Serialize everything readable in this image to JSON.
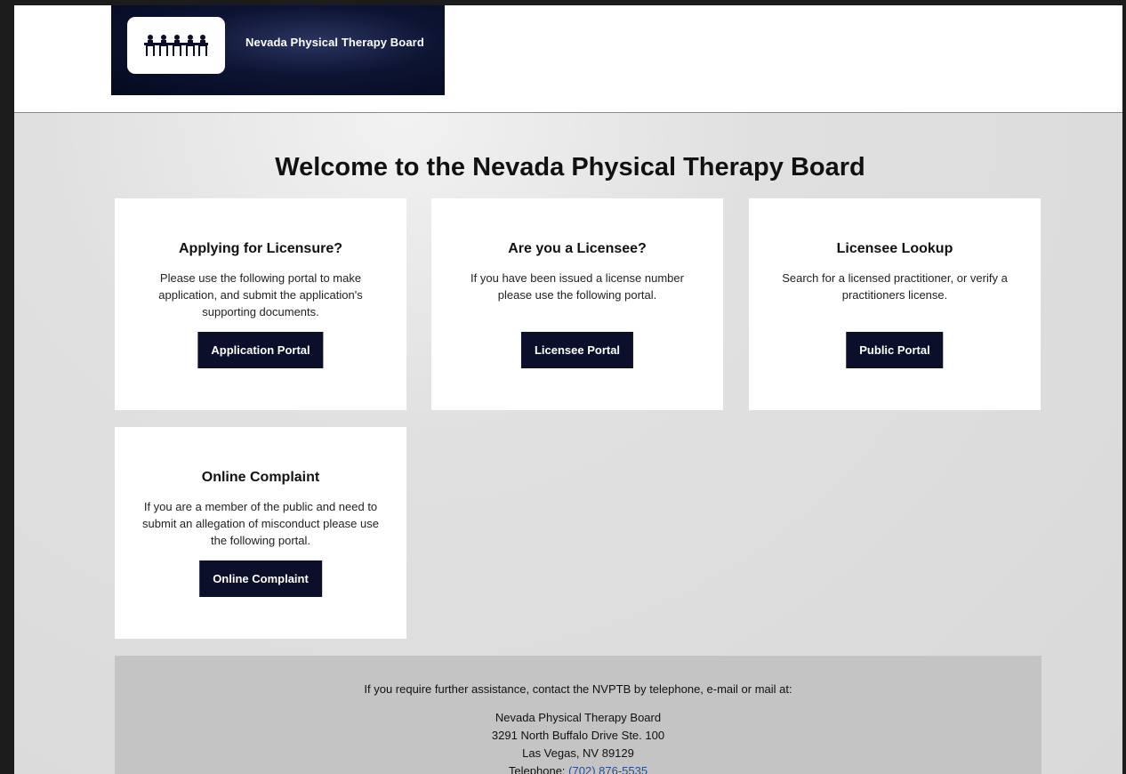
{
  "header": {
    "brand_title": "Nevada Physical Therapy Board",
    "logo_icon": "meeting-table-icon"
  },
  "main": {
    "welcome": "Welcome to the Nevada Physical Therapy Board",
    "cards": [
      {
        "title": "Applying for Licensure?",
        "text": "Please use the following portal to make application, and submit the application's supporting documents.",
        "button": "Application Portal"
      },
      {
        "title": "Are you a Licensee?",
        "text": "If you have been issued a license number please use the following portal.",
        "button": "Licensee Portal"
      },
      {
        "title": "Licensee Lookup",
        "text": "Search for a licensed practitioner, or verify a practitioners license.",
        "button": "Public Portal"
      },
      {
        "title": "Online Complaint",
        "text": "If you are a member of the public and need to submit an allegation of misconduct please use the following portal.",
        "button": "Online Complaint"
      }
    ]
  },
  "footer": {
    "assist": "If you require further assistance, contact the NVPTB by telephone, e-mail or mail at:",
    "org": "Nevada Physical Therapy Board",
    "street": "3291 North Buffalo Drive Ste. 100",
    "city": "Las Vegas, NV 89129",
    "phone_label": "Telephone:",
    "phone": "(702) 876-5535"
  },
  "colors": {
    "brand_navy": "#0b0f2a",
    "link_blue": "#2a4b8d"
  }
}
